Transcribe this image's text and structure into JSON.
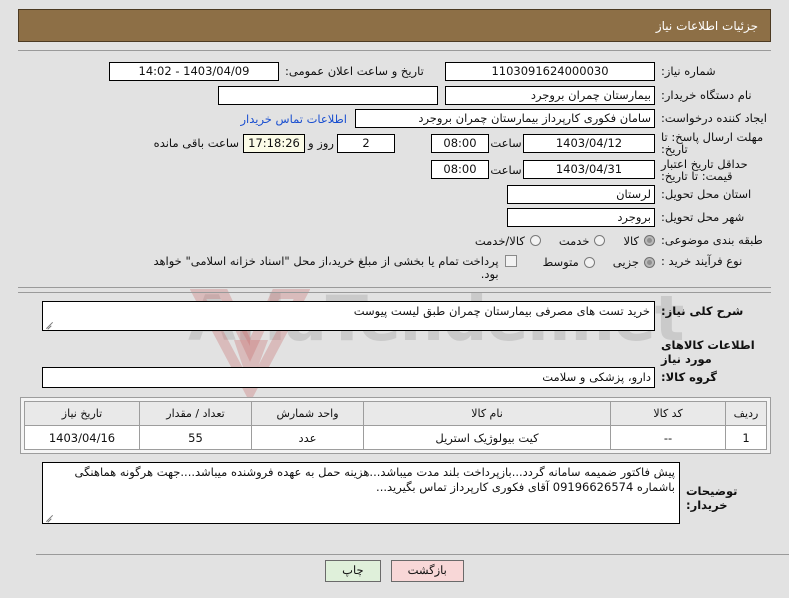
{
  "header": {
    "title": "جزئیات اطلاعات نیاز"
  },
  "form": {
    "need_number_label": "شماره نیاز:",
    "need_number_value": "1103091624000030",
    "announce_label": "تاریخ و ساعت اعلان عمومی:",
    "announce_value": "1403/04/09 - 14:02",
    "buyer_org_label": "نام دستگاه خریدار:",
    "buyer_org_value": "بیمارستان چمران بروجرد",
    "buyer_org_value2": "",
    "creator_label": "ایجاد کننده درخواست:",
    "creator_value": "سامان فکوری کارپرداز بیمارستان چمران بروجرد",
    "contact_link": "اطلاعات تماس خریدار",
    "deadline_label": "مهلت ارسال پاسخ: تا تاریخ:",
    "deadline_date": "1403/04/12",
    "hour_label": "ساعت",
    "deadline_time": "08:00",
    "days_remaining": "2",
    "days_word": "روز و",
    "clock_remaining": "17:18:26",
    "remaining_word": "ساعت باقی مانده",
    "price_valid_label": "حداقل تاریخ اعتبار قیمت: تا تاریخ:",
    "price_valid_date": "1403/04/31",
    "price_valid_time": "08:00",
    "province_label": "استان محل تحویل:",
    "province_value": "لرستان",
    "city_label": "شهر محل تحویل:",
    "city_value": "بروجرد",
    "category_label": "طبقه بندی موضوعی:",
    "category_options": [
      "کالا",
      "خدمت",
      "کالا/خدمت"
    ],
    "category_selected": 0,
    "process_label": "نوع فرآیند خرید :",
    "process_options": [
      "جزیی",
      "متوسط"
    ],
    "process_selected": 0,
    "treasury_checkbox_label": "پرداخت تمام یا بخشی از مبلغ خرید،از محل \"اسناد خزانه اسلامی\" خواهد بود.",
    "treasury_checked": false
  },
  "need_summary": {
    "label": "شرح کلی نیاز:",
    "value": "خرید تست های مصرفی بیمارستان چمران طبق لیست پیوست"
  },
  "goods_info": {
    "heading": "اطلاعات کالاهای مورد نیاز",
    "group_label": "گروه کالا:",
    "group_value": "دارو، پزشکی و سلامت"
  },
  "goods_table": {
    "columns": [
      "ردیف",
      "کد کالا",
      "نام کالا",
      "واحد شمارش",
      "تعداد / مقدار",
      "تاریخ نیاز"
    ],
    "rows": [
      {
        "row": "1",
        "code": "--",
        "name": "کیت بیولوژیک استریل",
        "unit": "عدد",
        "qty": "55",
        "date": "1403/04/16"
      }
    ]
  },
  "buyer_notes": {
    "label": "توضیحات خریدار:",
    "value": "پیش فاکتور ضمیمه سامانه گردد...بازپرداخت بلند مدت میباشد...هزینه حمل به عهده فروشنده میباشد....جهت هرگونه هماهنگی باشماره 09196626574 آقای فکوری کارپرداز تماس بگیرید..."
  },
  "buttons": {
    "back": "بازگشت",
    "print": "چاپ"
  },
  "watermark": {
    "text": "AriaTender.net"
  },
  "colors": {
    "header_bg": "#8d6f46",
    "page_bg": "#e2e2e2",
    "link": "#1a4fd0",
    "timer_bg": "#fbfbe7",
    "back_btn": "#f8d7d7",
    "print_btn": "#dff0da"
  }
}
